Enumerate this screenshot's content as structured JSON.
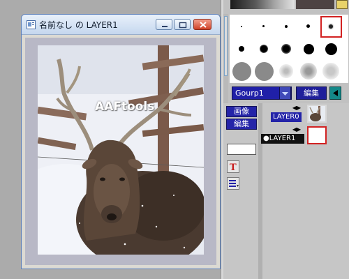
{
  "window": {
    "title": "名前なし の LAYER1",
    "watermark": "AAFtools"
  },
  "brush_panel": {
    "group_select": "Gourp1",
    "edit_button": "編集"
  },
  "layer_panel": {
    "image_button": "画像",
    "edit_button": "編集",
    "layers": [
      {
        "name": "LAYER0"
      },
      {
        "name": "LAYER1"
      }
    ]
  },
  "colors": {
    "accent_blue": "#2424a8",
    "selection_red": "#d22222",
    "teal": "#148888"
  }
}
